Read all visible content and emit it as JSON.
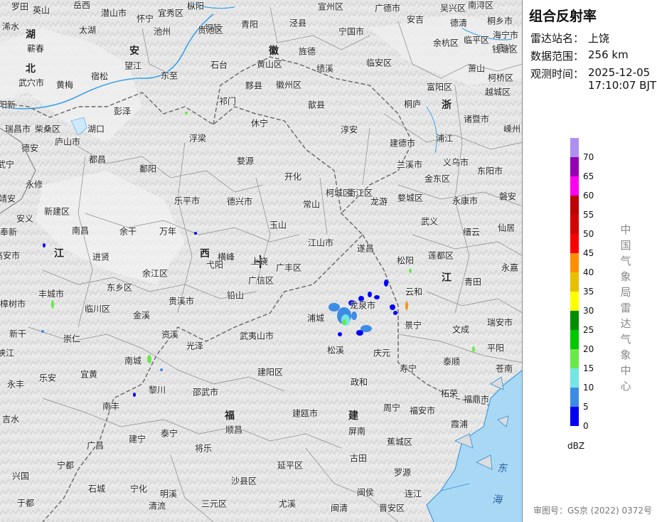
{
  "panel": {
    "title": "组合反射率",
    "station_label": "雷达站名：",
    "station_value": "上饶",
    "range_label": "数据范围：",
    "range_value": "256 km",
    "time_label": "观测时间：",
    "time_date": "2025-12-05",
    "time_clock": "17:10:07 BJT",
    "legend_unit": "dBZ",
    "agency": "中国气象局雷达气象中心",
    "footer": "审图号：GS京 (2022) 0372号"
  },
  "legend": [
    {
      "value": "70",
      "color": "#ad90f0"
    },
    {
      "value": "65",
      "color": "#9600b4"
    },
    {
      "value": "60",
      "color": "#ff00f0"
    },
    {
      "value": "55",
      "color": "#c00000"
    },
    {
      "value": "50",
      "color": "#d60000"
    },
    {
      "value": "45",
      "color": "#ff0000"
    },
    {
      "value": "40",
      "color": "#ff9000"
    },
    {
      "value": "35",
      "color": "#e7c000"
    },
    {
      "value": "30",
      "color": "#ffff00"
    },
    {
      "value": "25",
      "color": "#008e00"
    },
    {
      "value": "20",
      "color": "#00c800"
    },
    {
      "value": "15",
      "color": "#6ae84a"
    },
    {
      "value": "10",
      "color": "#73e6e6"
    },
    {
      "value": "5",
      "color": "#3c8ce6"
    },
    {
      "value": "0",
      "color": "#0000f6"
    }
  ],
  "map": {
    "radar_station": "上饶",
    "provinces": [
      {
        "name": "湖"
      },
      {
        "name": "北"
      },
      {
        "name": "安"
      },
      {
        "name": "徽"
      },
      {
        "name": "江"
      },
      {
        "name": "西"
      },
      {
        "name": "浙"
      },
      {
        "name": "江"
      },
      {
        "name": "福"
      },
      {
        "name": "建"
      }
    ],
    "seas": [
      "东",
      "海"
    ],
    "cities": [
      "罗田",
      "英山",
      "岳西",
      "潜山市",
      "怀宁",
      "宜秀区",
      "枞阳",
      "铜陵",
      "宣州区",
      "广德市",
      "吴兴区",
      "南浔区",
      "浠水",
      "太湖",
      "池州",
      "贵池区",
      "青阳",
      "泾县",
      "宁国市",
      "安吉",
      "德清",
      "桐乡市",
      "海宁市",
      "嘉兴",
      "蕲春",
      "望江",
      "石台",
      "黄山区",
      "旌德",
      "临安区",
      "余杭区",
      "临平区",
      "钱塘区",
      "萧山",
      "柯桥区",
      "武穴市",
      "黄梅",
      "宿松",
      "东至",
      "祁门",
      "黟县",
      "徽州区",
      "歙县",
      "绩溪",
      "桐庐",
      "富阳区",
      "越城区",
      "阳新",
      "瑞昌市",
      "柴桑区",
      "湖口",
      "彭泽",
      "浮梁",
      "休宁",
      "淳安",
      "建德市",
      "浦江",
      "诸暨市",
      "嵊州",
      "德安",
      "庐山市",
      "都昌",
      "鄱阳",
      "婺源",
      "开化",
      "兰溪市",
      "义乌市",
      "东阳市",
      "武宁",
      "永修",
      "乐平市",
      "德兴市",
      "常山",
      "柯城区",
      "衢江区",
      "龙游",
      "婺城区",
      "金东区",
      "永康市",
      "磐安",
      "靖安",
      "新建区",
      "余干",
      "万年",
      "玉山",
      "江山市",
      "遂昌",
      "武义",
      "缙云",
      "仙居",
      "奉新",
      "安义",
      "南昌",
      "进贤",
      "弋阳",
      "横峰",
      "上饶",
      "广丰区",
      "松阳",
      "莲都区",
      "永嘉",
      "高安市",
      "余江区",
      "东乡区",
      "铅山",
      "广信区",
      "云和",
      "青田",
      "丰城市",
      "临川区",
      "贵溪市",
      "金溪",
      "浦城",
      "庆元",
      "龙泉市",
      "景宁",
      "文成",
      "瑞安市",
      "樟树市",
      "新干",
      "崇仁",
      "资溪",
      "光泽",
      "武夷山市",
      "松溪",
      "平阳",
      "峡江",
      "南城",
      "乐安",
      "宜黄",
      "建阳区",
      "政和",
      "寿宁",
      "泰顺",
      "苍南",
      "永丰",
      "黎川",
      "邵武市",
      "周宁",
      "福安市",
      "柘荣",
      "福鼎市",
      "吉水",
      "南丰",
      "建瓯市",
      "屏南",
      "霞浦",
      "广昌",
      "建宁",
      "泰宁",
      "顺昌",
      "将乐",
      "蕉城区",
      "宁都",
      "古田",
      "罗源",
      "兴国",
      "宁化",
      "石城",
      "明溪",
      "三元区",
      "沙县区",
      "延平区",
      "闽侯",
      "连江",
      "于都",
      "清流",
      "尤溪",
      "闽清",
      "晋安区"
    ]
  }
}
